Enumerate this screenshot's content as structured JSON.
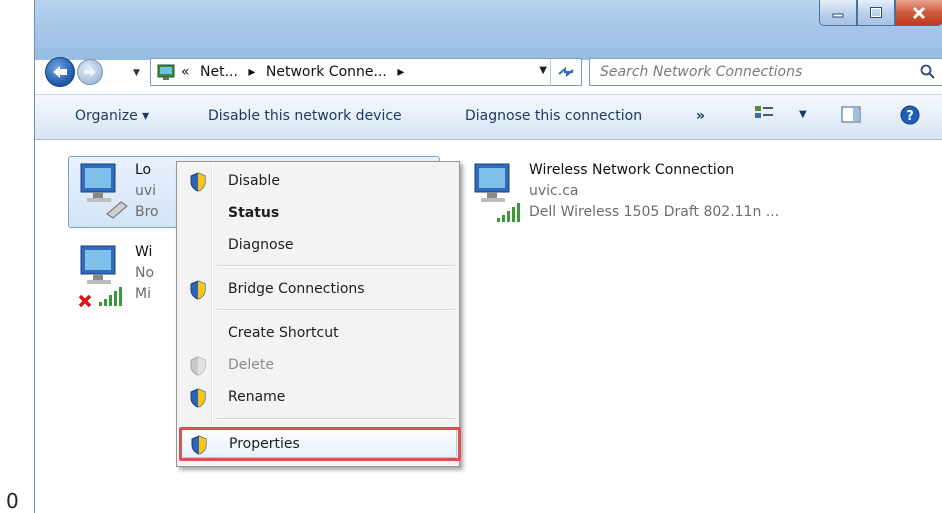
{
  "corner_label": "0",
  "window": {
    "controls": {
      "minimize": "minimize",
      "maximize": "maximize",
      "close": "close"
    }
  },
  "navbar": {
    "crumbs": [
      "«",
      "Net...",
      "▸",
      "Network Conne...",
      "▸"
    ],
    "search_placeholder": "Search Network Connections"
  },
  "toolbar": {
    "organize": "Organize ▾",
    "disable": "Disable this network device",
    "diagnose": "Diagnose this connection",
    "more": "»"
  },
  "connections": [
    {
      "name": "Lo",
      "line1": "uvi",
      "line2": "Bro"
    },
    {
      "name": "Wi",
      "line1": "No",
      "line2": "Mi"
    },
    {
      "name": "Wireless Network Connection",
      "line1": "uvic.ca",
      "line2": "Dell Wireless 1505 Draft 802.11n ..."
    }
  ],
  "context_menu": {
    "items": [
      {
        "label": "Disable",
        "icon": "shield-icon"
      },
      {
        "label": "Status",
        "bold": true
      },
      {
        "label": "Diagnose"
      },
      {
        "label": "Bridge Connections",
        "icon": "shield-icon"
      },
      {
        "label": "Create Shortcut"
      },
      {
        "label": "Delete",
        "icon": "shield-icon",
        "disabled": true
      },
      {
        "label": "Rename",
        "icon": "shield-icon"
      },
      {
        "label": "Properties",
        "icon": "shield-icon",
        "highlighted": true
      }
    ]
  },
  "colors": {
    "highlight_box": "#d9534f",
    "title_bar": "#a7c7e9"
  }
}
